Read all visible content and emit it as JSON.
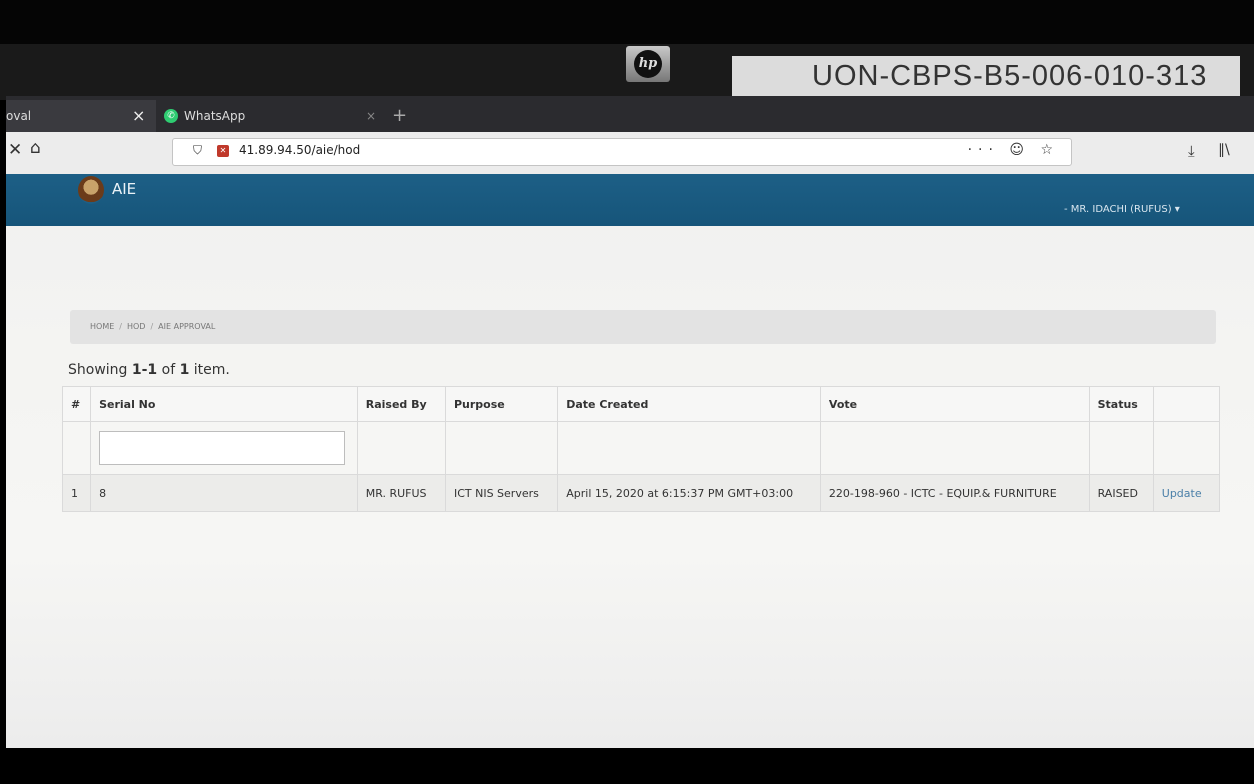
{
  "monitor": {
    "brand_logo": "hp",
    "asset_tag": "UON-CBPS-B5-006-010-313"
  },
  "browser": {
    "tabs": [
      {
        "label": "oval",
        "close": "×"
      },
      {
        "label": "WhatsApp",
        "close": "×",
        "icon": "whatsapp-icon"
      }
    ],
    "new_tab": "+",
    "nav_close": "✕",
    "nav_home": "⌂",
    "url": "41.89.94.50/aie/hod",
    "url_actions": "··· ☺ ☆",
    "download_icon": "⤓",
    "library_icon": "∥\\"
  },
  "app": {
    "name": "AIE",
    "user_menu": "- MR. IDACHI (RUFUS) ▾",
    "header_color": "#1b5a80"
  },
  "breadcrumb": {
    "home": "HOME",
    "sep": "/",
    "hod": "HOD",
    "current": "AIE APPROVAL"
  },
  "summary": {
    "prefix": "Showing ",
    "range": "1-1",
    "middle": " of ",
    "total": "1",
    "suffix": " item."
  },
  "table": {
    "columns": {
      "num": "#",
      "serial": "Serial No",
      "raised_by": "Raised By",
      "purpose": "Purpose",
      "date_created": "Date Created",
      "vote": "Vote",
      "status": "Status",
      "action": ""
    },
    "filter_placeholder": "",
    "rows": [
      {
        "num": "1",
        "serial": "8",
        "raised_by": "MR. RUFUS",
        "purpose": "ICT NIS Servers",
        "date_created": "April 15, 2020 at 6:15:37 PM GMT+03:00",
        "vote": "220-198-960 - ICTC - EQUIP.& FURNITURE",
        "status": "RAISED",
        "action": "Update"
      }
    ]
  }
}
